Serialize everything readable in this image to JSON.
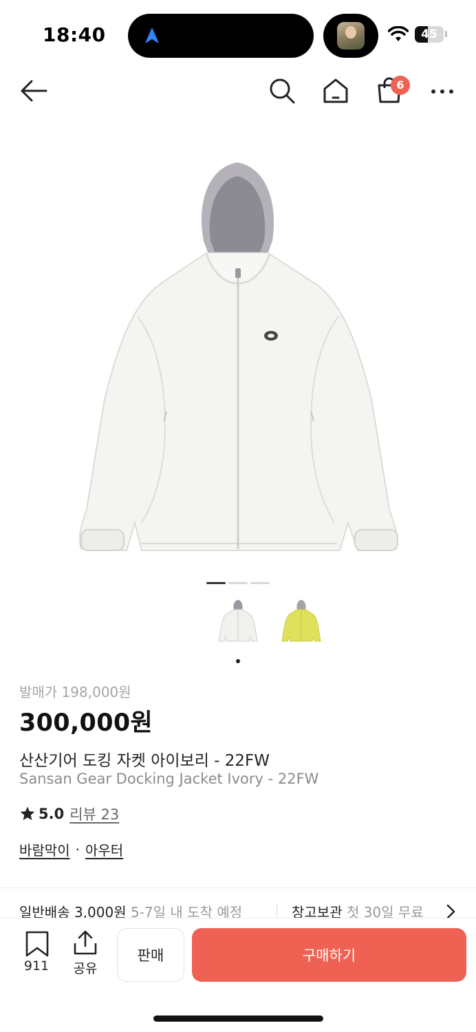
{
  "status_bar": {
    "time": "18:40",
    "battery": "45",
    "battery_level_percent": 45
  },
  "nav": {
    "cart_count": "6",
    "icons": [
      "back-arrow-icon",
      "search-icon",
      "home-icon",
      "shopping-bag-icon",
      "more-icon"
    ]
  },
  "gallery": {
    "image_count": 3,
    "active_index": 0,
    "variants": [
      "ivory",
      "yellow"
    ],
    "selected_variant": 0
  },
  "product": {
    "release_price": "발매가 198,000원",
    "price": "300,000원",
    "name_ko": "산산기어 도킹 자켓 아이보리 - 22FW",
    "name_en": "Sansan Gear Docking Jacket Ivory - 22FW",
    "rating": "5.0",
    "review_label": "리뷰 23",
    "category_1": "바람막이",
    "category_sep": "·",
    "category_2": "아우터"
  },
  "shipping": {
    "title": "일반배송 3,000원",
    "sub": "5-7일 내 도착 예정",
    "warehouse_title": "창고보관",
    "warehouse_sub": "첫 30일 무료"
  },
  "bottom_bar": {
    "bookmark_count": "911",
    "share_label": "공유",
    "sell_label": "판매",
    "buy_label": "구매하기"
  },
  "colors": {
    "accent": "#ef6253",
    "text": "#222222",
    "muted": "#a5a5a5"
  }
}
